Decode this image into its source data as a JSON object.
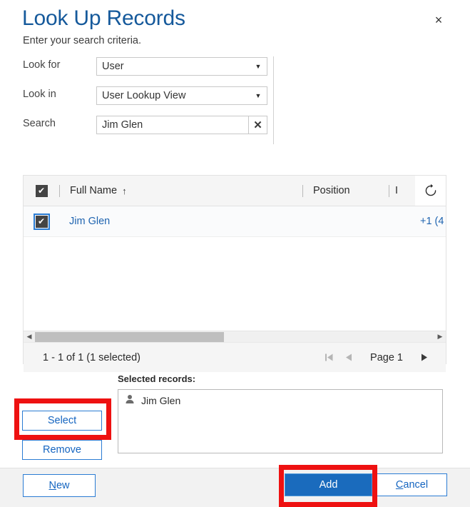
{
  "header": {
    "title": "Look Up Records",
    "subtitle": "Enter your search criteria.",
    "close_label": "×"
  },
  "criteria": {
    "rows": [
      {
        "label": "Look for",
        "value": "User",
        "type": "select",
        "caret": "▼"
      },
      {
        "label": "Look in",
        "value": "User Lookup View",
        "type": "select",
        "caret": "▼"
      },
      {
        "label": "Search",
        "value": "Jim Glen",
        "placeholder": "Search",
        "type": "text",
        "clear": "✕"
      }
    ]
  },
  "grid": {
    "select_all_checked": true,
    "check_glyph": "✔",
    "columns": [
      {
        "label": "Full Name",
        "sorted": true,
        "sort_glyph": "↑"
      },
      {
        "label": "Position",
        "sorted": false,
        "sort_glyph": ""
      },
      {
        "label": "I",
        "sorted": false,
        "sort_glyph": ""
      }
    ],
    "refresh_icon": "refresh-icon",
    "rows": [
      {
        "checked": true,
        "full_name": "Jim Glen",
        "phone": "+1 (4"
      }
    ],
    "scrollbar": {
      "left_arrow": "◀",
      "right_arrow": "▶"
    },
    "footer": {
      "record_count": "1 - 1 of 1 (1 selected)",
      "page_label": "Page 1",
      "first_glyph": "⏮",
      "prev_glyph": "◀",
      "next_glyph": "▶"
    }
  },
  "selected": {
    "label": "Selected records:",
    "items": [
      {
        "name": "Jim Glen",
        "icon": "user-icon"
      }
    ],
    "select_button": "Select",
    "remove_button": "Remove"
  },
  "footer": {
    "new_button": {
      "prefix": "",
      "accel": "N",
      "suffix": "ew"
    },
    "add_button": "Add",
    "cancel_button": {
      "prefix": "",
      "accel": "C",
      "suffix": "ancel"
    }
  },
  "colors": {
    "title_blue": "#15599b",
    "link_blue": "#1f64b0",
    "button_blue": "#1a6bbd",
    "button_border_blue": "#2b7cd3",
    "highlight_red": "#ee1111",
    "header_gray": "#f5f5f5"
  }
}
